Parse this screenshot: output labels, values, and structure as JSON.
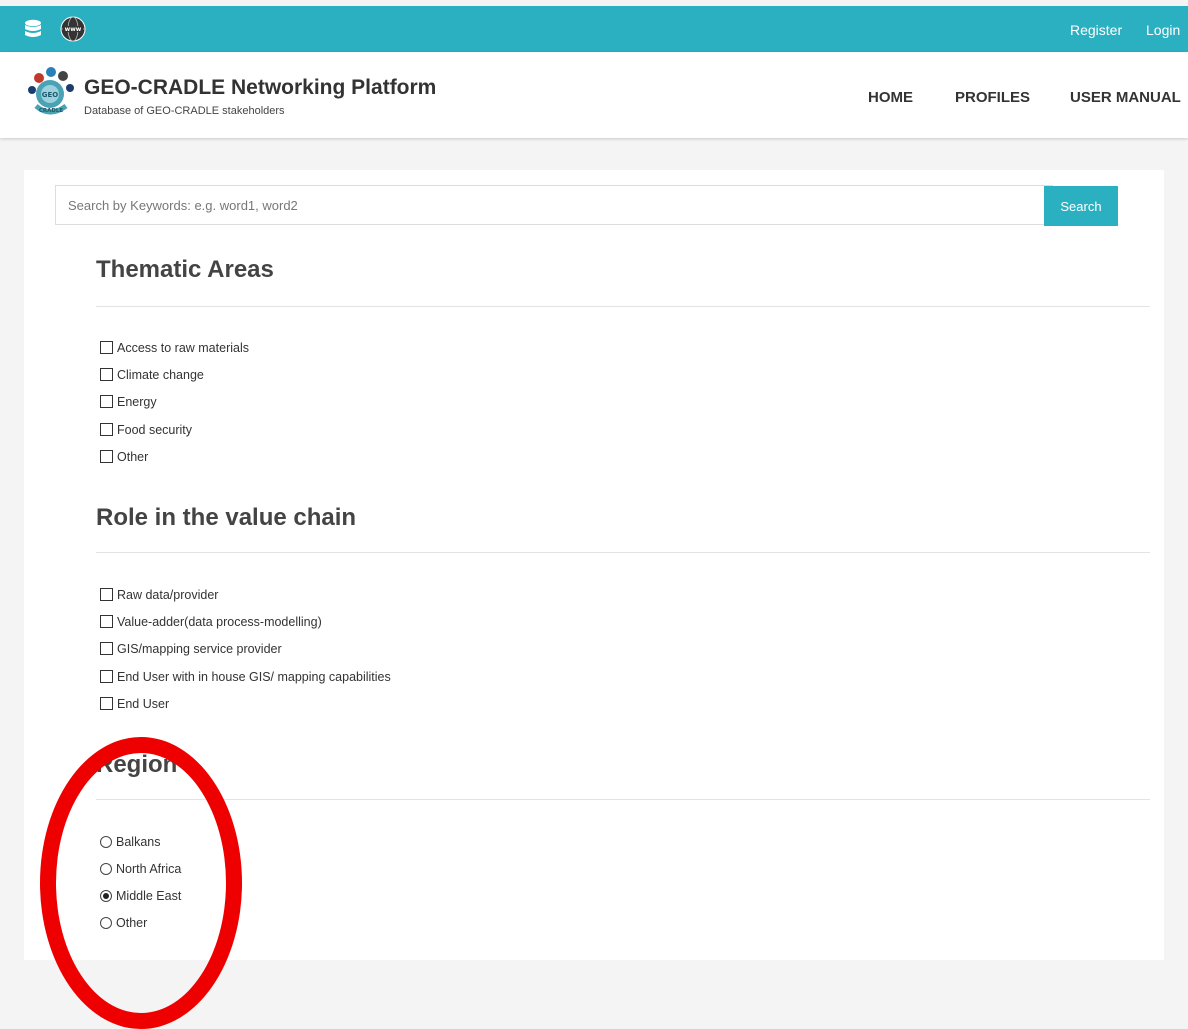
{
  "topbar": {
    "register_label": "Register",
    "login_label": "Login",
    "icons": [
      "database-icon",
      "www-globe-icon"
    ],
    "accent_color": "#2bb0c2"
  },
  "header": {
    "title": "GEO-CRADLE Networking Platform",
    "subtitle": "Database of GEO-CRADLE stakeholders",
    "logo_text": "CRADLE",
    "nav": {
      "home": "HOME",
      "profiles": "PROFILES",
      "user_manual": "USER MANUAL"
    }
  },
  "search": {
    "placeholder": "Search by Keywords: e.g. word1, word2",
    "value": "",
    "button_label": "Search"
  },
  "sections": {
    "thematic": {
      "title": "Thematic Areas",
      "options": [
        "Access to raw materials",
        "Climate change",
        "Energy",
        "Food security",
        "Other"
      ]
    },
    "role": {
      "title": "Role in the value chain",
      "options": [
        "Raw data/provider",
        "Value-adder(data process-modelling)",
        "GIS/mapping service provider",
        "End User with in house GIS/ mapping capabilities",
        "End User"
      ]
    },
    "region": {
      "title": "Region",
      "options": [
        "Balkans",
        "North Africa",
        "Middle East",
        "Other"
      ],
      "selected": "Middle East"
    }
  },
  "annotation": {
    "color": "#ee0000"
  }
}
